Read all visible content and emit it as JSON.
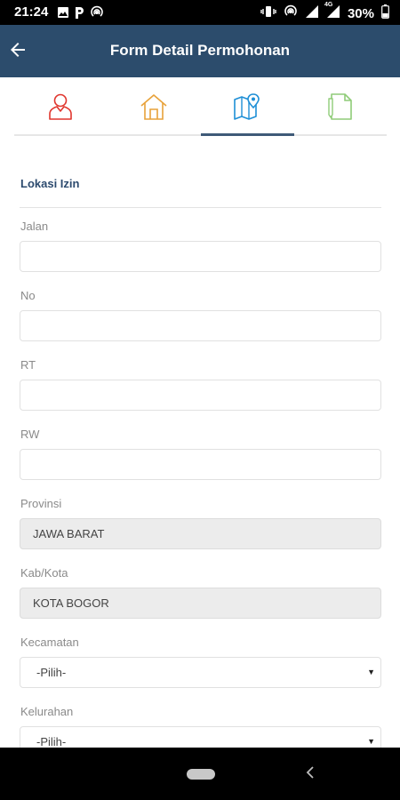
{
  "status": {
    "time": "21:24",
    "battery": "30%",
    "network": "4G",
    "icons": [
      "image-icon",
      "p-icon",
      "hotspot-icon",
      "vibrate-icon",
      "hotspot-icon",
      "signal-icon",
      "signal-4g-icon",
      "battery-icon"
    ]
  },
  "appbar": {
    "title": "Form Detail Permohonan",
    "back_icon": "arrow-left-icon"
  },
  "tabs": [
    {
      "icon": "person-icon",
      "color": "#e0352d",
      "active": false
    },
    {
      "icon": "house-icon",
      "color": "#e8a23a",
      "active": false
    },
    {
      "icon": "map-location-icon",
      "color": "#1e8fd6",
      "active": true
    },
    {
      "icon": "document-icon",
      "color": "#8fcc78",
      "active": false
    }
  ],
  "form": {
    "section_title": "Lokasi Izin",
    "fields": [
      {
        "label": "Jalan",
        "value": "",
        "type": "text"
      },
      {
        "label": "No",
        "value": "",
        "type": "text"
      },
      {
        "label": "RT",
        "value": "",
        "type": "text"
      },
      {
        "label": "RW",
        "value": "",
        "type": "text"
      },
      {
        "label": "Provinsi",
        "value": "JAWA BARAT",
        "type": "readonly"
      },
      {
        "label": "Kab/Kota",
        "value": "KOTA BOGOR",
        "type": "readonly"
      },
      {
        "label": "Kecamatan",
        "value": "-Pilih-",
        "type": "select"
      },
      {
        "label": "Kelurahan",
        "value": "-Pilih-",
        "type": "select"
      }
    ]
  },
  "colors": {
    "appbar": "#2c4c6c",
    "section_title": "#2c4a6e",
    "label": "#8a8a8a"
  }
}
